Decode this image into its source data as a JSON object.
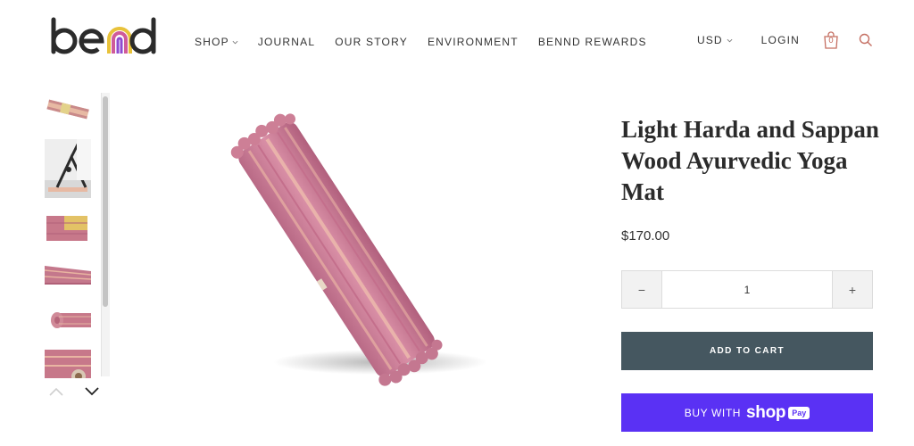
{
  "brand": {
    "name": "bend",
    "colors": {
      "accent_coral": "#c56f62",
      "logo_yellow": "#e8c23a",
      "logo_pink": "#cf5b9a",
      "logo_purple": "#8e4bd1"
    }
  },
  "nav": {
    "items": [
      {
        "label": "SHOP",
        "has_dropdown": true
      },
      {
        "label": "JOURNAL",
        "has_dropdown": false
      },
      {
        "label": "OUR STORY",
        "has_dropdown": false
      },
      {
        "label": "ENVIRONMENT",
        "has_dropdown": false
      },
      {
        "label": "BENND REWARDS",
        "has_dropdown": false
      }
    ]
  },
  "header": {
    "currency": "USD",
    "login_label": "LOGIN",
    "cart_count": "0",
    "icons": [
      "cart-icon",
      "search-icon",
      "chevron-down-icon"
    ]
  },
  "gallery": {
    "thumbnails": [
      {
        "name": "flat-mat"
      },
      {
        "name": "yoga-pose"
      },
      {
        "name": "folded-mat"
      },
      {
        "name": "mat-edge"
      },
      {
        "name": "rolled-mat"
      },
      {
        "name": "mat-detail"
      }
    ],
    "arrows": [
      "chevron-up-icon",
      "chevron-down-icon"
    ]
  },
  "product": {
    "title": "Light Harda and Sappan Wood Ayurvedic Yoga Mat",
    "price": "$170.00",
    "quantity": {
      "minus_label": "−",
      "value": "1",
      "plus_label": "+"
    },
    "add_to_cart_label": "ADD TO CART",
    "shop_pay": {
      "buy_with_label": "BUY WITH",
      "shop_label": "shop",
      "pay_label": "Pay",
      "color": "#5a31f4"
    },
    "add_to_cart_color": "#455760"
  }
}
